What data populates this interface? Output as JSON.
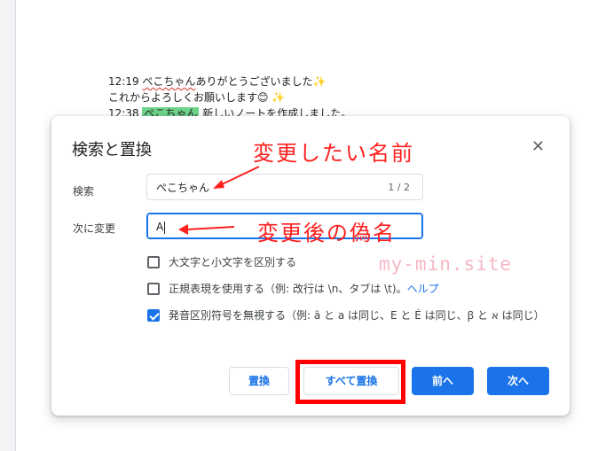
{
  "document": {
    "line1_time": "12:19",
    "line1_name": "ぺこちゃん",
    "line1_text": "ありがとうございました",
    "line1_emoji": "✨",
    "line2_text": "これからよろしくお願いします",
    "line2_emoji1": "😊",
    "line2_emoji2": "✨",
    "line3_time": "12:38",
    "line3_name": "ぺこちゃん",
    "line3_text": "新しいノートを作成しました。"
  },
  "dialog": {
    "title": "検索と置換",
    "close_icon": "✕",
    "find_label": "検索",
    "find_value": "ぺこちゃん",
    "find_count": "1 / 2",
    "replace_label": "次に変更",
    "replace_value": "A",
    "options": [
      {
        "label": "大文字と小文字を区別する",
        "checked": false
      },
      {
        "label": "正規表現を使用する（例: 改行は \\n、タブは \\t)。",
        "checked": false
      },
      {
        "label": "発音区別符号を無視する（例: ä と a は同じ、E と É は同じ、ꞵ と א は同じ）",
        "checked": true
      }
    ],
    "help_link": "ヘルプ",
    "buttons": {
      "replace": "置換",
      "replace_all": "すべて置換",
      "prev": "前へ",
      "next": "次へ"
    }
  },
  "annotations": {
    "find_note": "変更したい名前",
    "replace_note": "変更後の偽名",
    "color": "#ff2020"
  },
  "watermark": "my-min.site",
  "colors": {
    "accent": "#1a73e8",
    "highlight": "#6fd48a",
    "annotation_box": "#ff0000"
  }
}
